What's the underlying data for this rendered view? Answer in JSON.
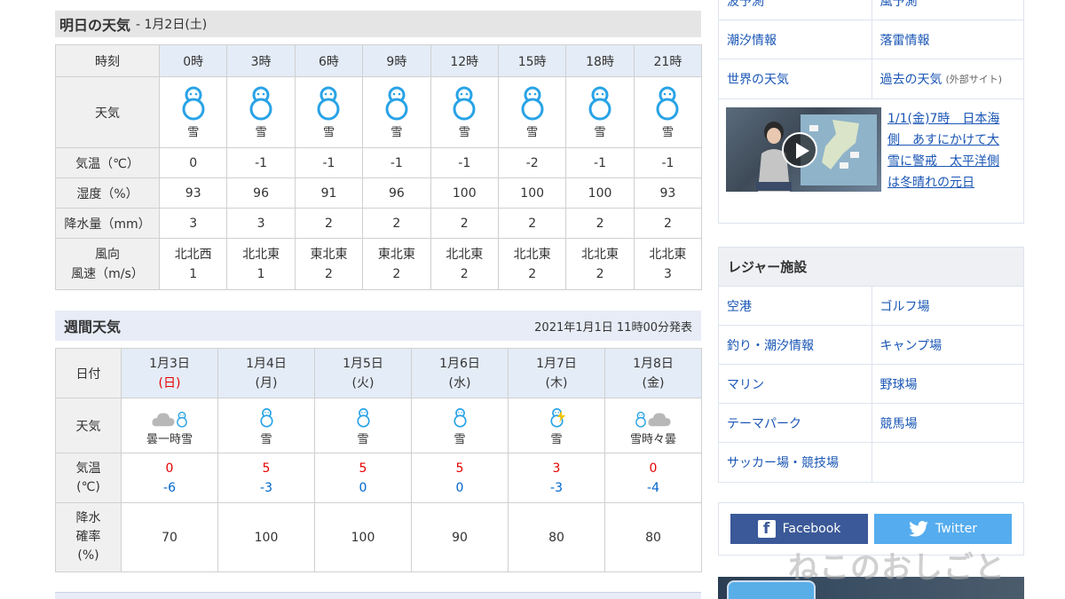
{
  "tomorrow": {
    "title": "明日の天気",
    "date": "- 1月2日(土)",
    "headers": {
      "time": "時刻",
      "weather": "天気",
      "temp": "気温（℃）",
      "humidity": "湿度（%）",
      "precip": "降水量（mm）",
      "wind_dir": "風向",
      "wind_speed": "風速（m/s）"
    },
    "hours": [
      {
        "time": "0時",
        "cond": "雪",
        "temp": "0",
        "humidity": "93",
        "precip": "3",
        "dir": "北北西",
        "speed": "1"
      },
      {
        "time": "3時",
        "cond": "雪",
        "temp": "-1",
        "humidity": "96",
        "precip": "3",
        "dir": "北北東",
        "speed": "1"
      },
      {
        "time": "6時",
        "cond": "雪",
        "temp": "-1",
        "humidity": "91",
        "precip": "2",
        "dir": "東北東",
        "speed": "2"
      },
      {
        "time": "9時",
        "cond": "雪",
        "temp": "-1",
        "humidity": "96",
        "precip": "2",
        "dir": "東北東",
        "speed": "2"
      },
      {
        "time": "12時",
        "cond": "雪",
        "temp": "-1",
        "humidity": "100",
        "precip": "2",
        "dir": "北北東",
        "speed": "2"
      },
      {
        "time": "15時",
        "cond": "雪",
        "temp": "-2",
        "humidity": "100",
        "precip": "2",
        "dir": "北北東",
        "speed": "2"
      },
      {
        "time": "18時",
        "cond": "雪",
        "temp": "-1",
        "humidity": "100",
        "precip": "2",
        "dir": "北北東",
        "speed": "2"
      },
      {
        "time": "21時",
        "cond": "雪",
        "temp": "-1",
        "humidity": "93",
        "precip": "2",
        "dir": "北北東",
        "speed": "3"
      }
    ]
  },
  "weekly": {
    "title": "週間天気",
    "issued": "2021年1月1日 11時00分発表",
    "headers": {
      "date": "日付",
      "weather": "天気",
      "temp_l1": "気温",
      "temp_l2": "(℃)",
      "pop_l1": "降水",
      "pop_l2": "確率",
      "pop_l3": "(%)"
    },
    "days": [
      {
        "date": "1月3日",
        "dow": "(日)",
        "dow_color": "#e60000",
        "icon": "cloud-snow-icon",
        "cond": "曇一時雪",
        "high": "0",
        "low": "-6",
        "pop": "70"
      },
      {
        "date": "1月4日",
        "dow": "(月)",
        "dow_color": "#333333",
        "icon": "snowman-icon",
        "cond": "雪",
        "high": "5",
        "low": "-3",
        "pop": "100"
      },
      {
        "date": "1月5日",
        "dow": "(火)",
        "dow_color": "#333333",
        "icon": "snowman-icon",
        "cond": "雪",
        "high": "5",
        "low": "0",
        "pop": "100"
      },
      {
        "date": "1月6日",
        "dow": "(水)",
        "dow_color": "#333333",
        "icon": "snowman-icon",
        "cond": "雪",
        "high": "5",
        "low": "0",
        "pop": "90"
      },
      {
        "date": "1月7日",
        "dow": "(木)",
        "dow_color": "#333333",
        "icon": "snow-thunder-icon",
        "cond": "雪",
        "high": "3",
        "low": "-3",
        "pop": "80"
      },
      {
        "date": "1月8日",
        "dow": "(金)",
        "dow_color": "#333333",
        "icon": "snow-cloud-icon",
        "cond": "雪時々曇",
        "high": "0",
        "low": "-4",
        "pop": "80"
      }
    ]
  },
  "sidebar": {
    "top_links": [
      [
        "波予測",
        "風予測"
      ],
      [
        "潮汐情報",
        "落雷情報"
      ],
      [
        "世界の天気",
        "過去の天気"
      ]
    ],
    "external_note": "(外部サイト)",
    "video": {
      "caption": "1/1(金)7時　日本海側　あすにかけて大雪に警戒　太平洋側は冬晴れの元日"
    },
    "leisure_title": "レジャー施設",
    "leisure_links": [
      [
        "空港",
        "ゴルフ場"
      ],
      [
        "釣り・潮汐情報",
        "キャンプ場"
      ],
      [
        "マリン",
        "野球場"
      ],
      [
        "テーマパーク",
        "競馬場"
      ],
      [
        "サッカー場・競技場",
        ""
      ]
    ],
    "facebook_label": "Facebook",
    "twitter_label": "Twitter"
  },
  "watermark": "ねこのおしごと",
  "colors": {
    "snow_icon": "#29a3e6",
    "link": "#1a56b5",
    "high_temp": "#e60000",
    "low_temp": "#0066cc"
  }
}
